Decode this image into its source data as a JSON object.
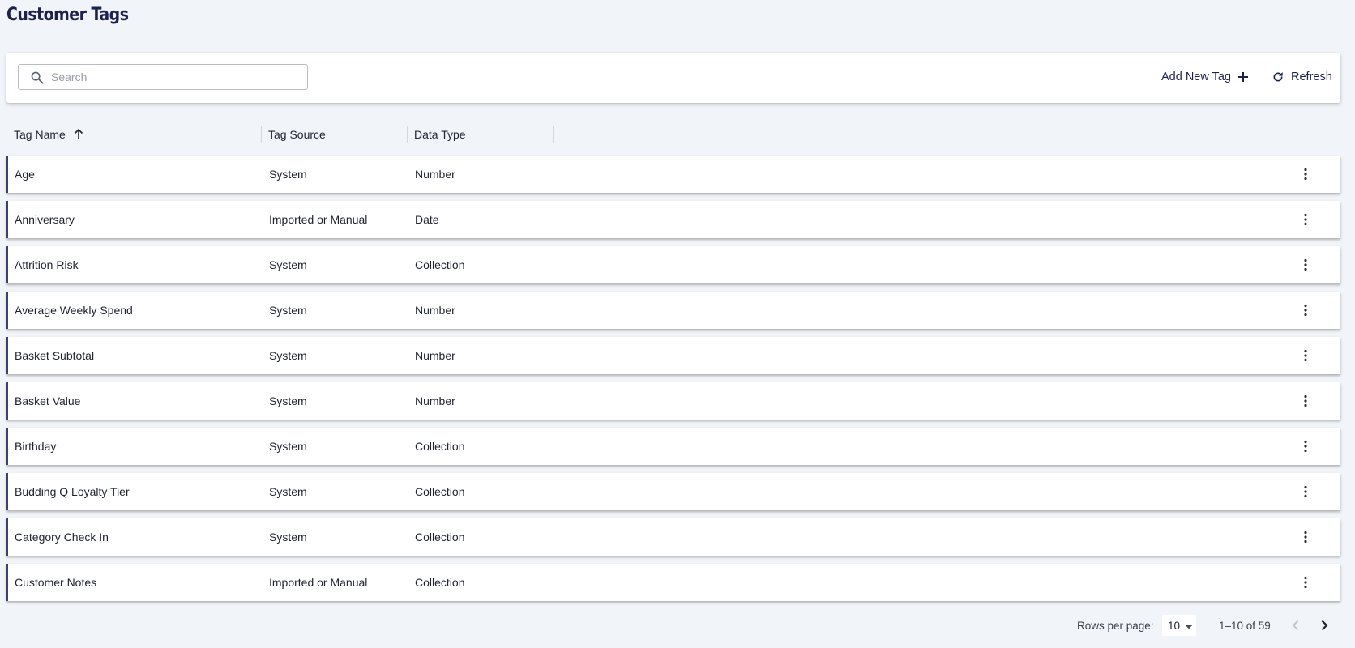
{
  "page": {
    "title": "Customer Tags"
  },
  "toolbar": {
    "search_placeholder": "Search",
    "search_value": "",
    "add_label": "Add New Tag",
    "refresh_label": "Refresh"
  },
  "table": {
    "columns": [
      "Tag Name",
      "Tag Source",
      "Data Type"
    ],
    "sorted_column": "Tag Name",
    "sort_direction": "ascending",
    "rows": [
      {
        "name": "Age",
        "source": "System",
        "type": "Number"
      },
      {
        "name": "Anniversary",
        "source": "Imported or Manual",
        "type": "Date"
      },
      {
        "name": "Attrition Risk",
        "source": "System",
        "type": "Collection"
      },
      {
        "name": "Average Weekly Spend",
        "source": "System",
        "type": "Number"
      },
      {
        "name": "Basket Subtotal",
        "source": "System",
        "type": "Number"
      },
      {
        "name": "Basket Value",
        "source": "System",
        "type": "Number"
      },
      {
        "name": "Birthday",
        "source": "System",
        "type": "Collection"
      },
      {
        "name": "Budding Q Loyalty Tier",
        "source": "System",
        "type": "Collection"
      },
      {
        "name": "Category Check In",
        "source": "System",
        "type": "Collection"
      },
      {
        "name": "Customer Notes",
        "source": "Imported or Manual",
        "type": "Collection"
      }
    ]
  },
  "pagination": {
    "rows_per_page_label": "Rows per page:",
    "rows_per_page": "10",
    "range": "1–10 of 59"
  },
  "icons": {
    "search": "search-icon",
    "add": "plus-icon",
    "refresh": "refresh-icon",
    "sort": "arrow-up-icon",
    "row_menu": "more-vertical-icon",
    "prev": "chevron-left-icon",
    "next": "chevron-right-icon"
  },
  "colors": {
    "accent": "#1d2150",
    "row_marker": "#3c4170",
    "background": "#f1f4f8"
  }
}
